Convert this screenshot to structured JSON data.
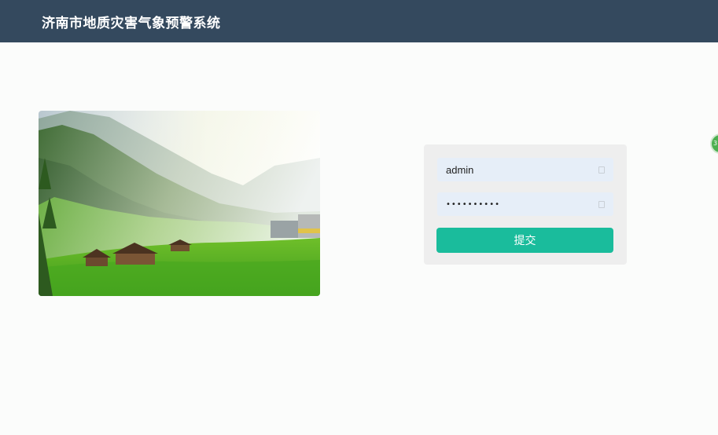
{
  "header": {
    "title": "济南市地质灾害气象预警系统"
  },
  "login": {
    "username_value": "admin",
    "password_value": "••••••••••",
    "submit_label": "提交"
  },
  "side_widget": {
    "label": "3"
  },
  "colors": {
    "header_bg": "#34495e",
    "submit_bg": "#1abc9c",
    "panel_bg": "#eeeeee",
    "input_bg": "#e6eef8"
  }
}
